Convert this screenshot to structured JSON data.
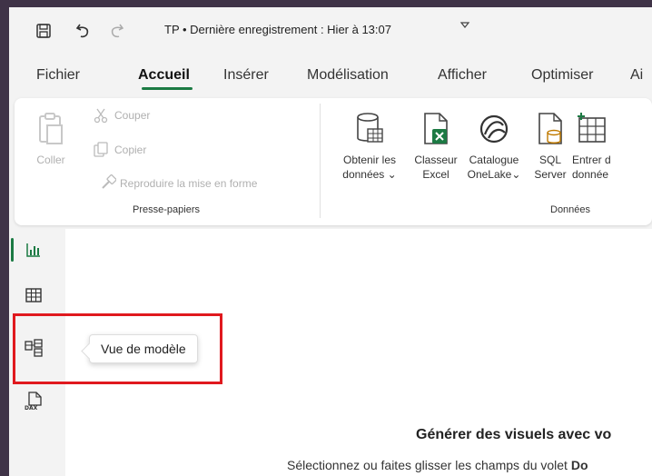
{
  "titlebar": {
    "title": "TP • Dernière enregistrement : Hier à 13:07",
    "icons": [
      "save-icon",
      "undo-icon",
      "redo-icon",
      "chevron-down-icon"
    ]
  },
  "menu": {
    "items": [
      "Fichier",
      "Accueil",
      "Insérer",
      "Modélisation",
      "Afficher",
      "Optimiser",
      "Ai"
    ],
    "active": "Accueil"
  },
  "ribbon": {
    "clipboard": {
      "paste": "Coller",
      "cut": "Couper",
      "copy": "Copier",
      "format_painter": "Reproduire la mise en forme",
      "group_label": "Presse-papiers"
    },
    "data": {
      "get_data": [
        "Obtenir les",
        "données"
      ],
      "excel": [
        "Classeur",
        "Excel"
      ],
      "onelake": [
        "Catalogue",
        "OneLake"
      ],
      "sql": [
        "SQL",
        "Server"
      ],
      "enter_data": [
        "Entrer d",
        "donnée"
      ],
      "group_label": "Données"
    }
  },
  "leftnav": {
    "items": [
      "report-view-icon",
      "table-view-icon",
      "model-view-icon",
      "dax-query-view-icon"
    ],
    "tooltip": "Vue de modèle"
  },
  "canvas": {
    "title": "Générer des visuels avec vo",
    "subtitle_prefix": "Sélectionnez ou faites glisser les champs du volet ",
    "subtitle_bold": "Do"
  },
  "colors": {
    "accent": "#1b7a43",
    "highlight": "#e0191e",
    "background": "#3f3347"
  }
}
